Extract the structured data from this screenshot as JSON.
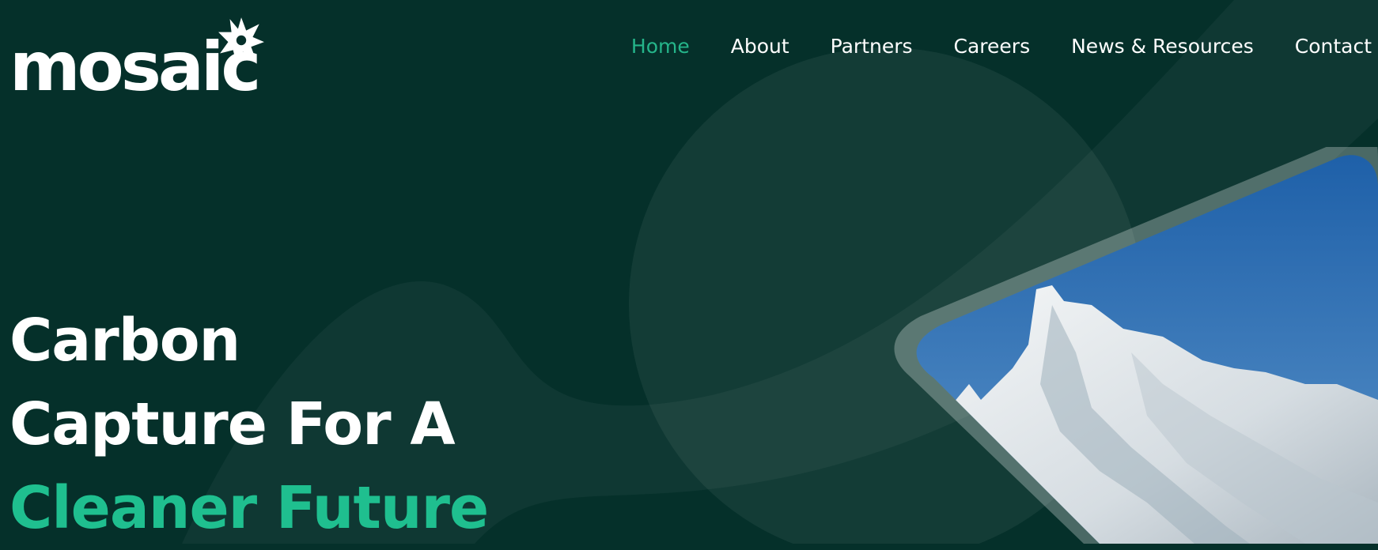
{
  "brand": {
    "name": "mosaic",
    "logo_icon": "sparkle-star-icon"
  },
  "colors": {
    "background": "#05302a",
    "accent": "#1fbf8f",
    "nav_active": "#25b58a",
    "text": "#ffffff"
  },
  "nav": {
    "items": [
      {
        "label": "Home",
        "active": true
      },
      {
        "label": "About"
      },
      {
        "label": "Partners"
      },
      {
        "label": "Careers"
      },
      {
        "label": "News & Resources"
      },
      {
        "label": "Contact"
      }
    ]
  },
  "hero": {
    "line1": "Carbon",
    "line2": "Capture For A",
    "line3": "Cleaner Future",
    "image": "iceberg-photo"
  }
}
